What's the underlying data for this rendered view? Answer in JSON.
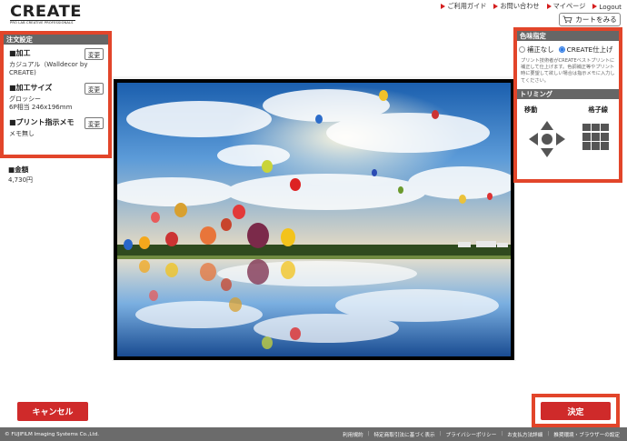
{
  "header": {
    "logo_main": "CREATE",
    "logo_sub": "PRO LAB CREATIVE PROFESSIONALS",
    "nav": [
      "ご利用ガイド",
      "お問い合わせ",
      "マイページ",
      "Logout"
    ],
    "cart_label": "カートをみる"
  },
  "order": {
    "heading": "注文設定",
    "sections": [
      {
        "title": "■加工",
        "value": "カジュアル（Walldecor by CREATE)",
        "button": "変更"
      },
      {
        "title": "■加工サイズ",
        "value": "グロッシー",
        "value2": "6P相当 246x196mm",
        "button": "変更"
      },
      {
        "title": "■プリント指示メモ",
        "value": "メモ無し",
        "button": "変更"
      }
    ],
    "price_title": "■金額",
    "price_value": "4,730円"
  },
  "color": {
    "heading": "色味指定",
    "option_none": "補正なし",
    "option_create": "CREATE仕上げ",
    "selected": "CREATE仕上げ",
    "note": "プリント技術者がCREATEベストプリントに補正して仕上げます。色調補正等やプリント時に要望して欲しい場合は指示メモに入力してください。"
  },
  "trimming": {
    "heading": "トリミング",
    "move_label": "移動",
    "grid_label": "格子線"
  },
  "actions": {
    "cancel": "キャンセル",
    "confirm": "決定"
  },
  "footer": {
    "copyright": "© FUJIFILM Imaging Systems Co.,Ltd.",
    "links": [
      "利用規約",
      "特定商取引法に基づく表示",
      "プライバシーポリシー",
      "お支払方法詳細",
      "推奨環境・ブラウザーの設定"
    ]
  },
  "colors": {
    "accent_red": "#cf2a2a",
    "highlight_border": "#e2452a",
    "panel_header": "#666666",
    "footer_bg": "#6b6b6b",
    "radio_blue": "#2f7be5"
  },
  "icons": [
    "nav-arrow-icon",
    "cart-icon",
    "direction-pad-icon",
    "grid-lines-icon"
  ]
}
